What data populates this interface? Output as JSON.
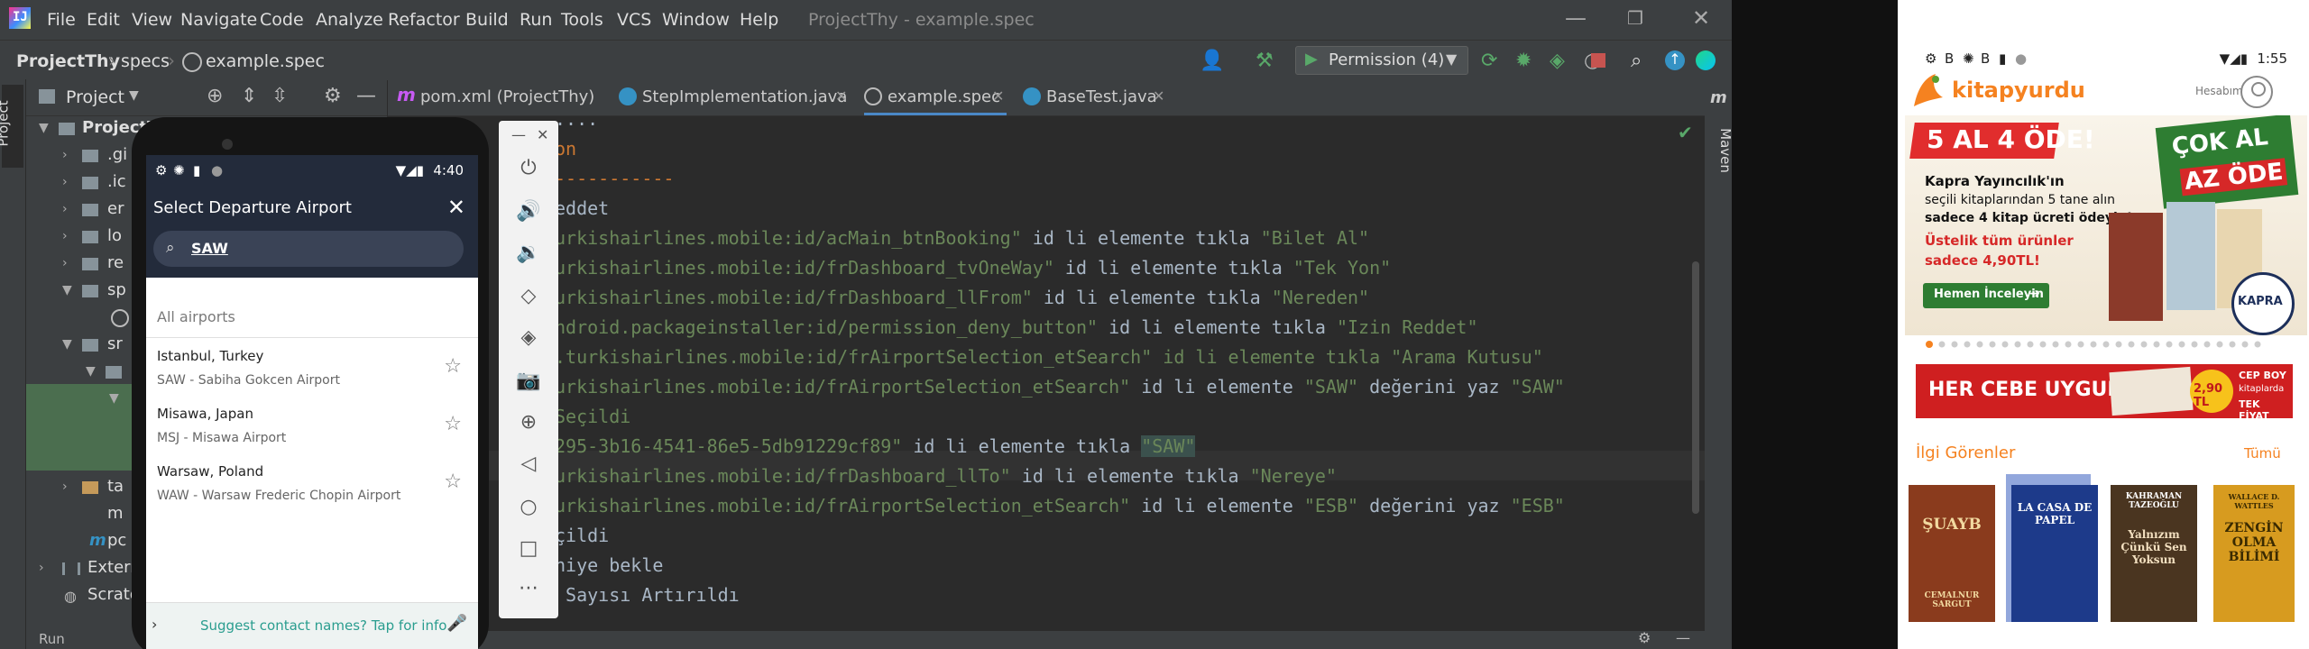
{
  "menubar": {
    "items": [
      "File",
      "Edit",
      "View",
      "Navigate",
      "Code",
      "Analyze",
      "Refactor",
      "Build",
      "Run",
      "Tools",
      "VCS",
      "Window",
      "Help"
    ],
    "window_title": "ProjectThy - example.spec",
    "controls": [
      "—",
      "❐",
      "✕"
    ]
  },
  "navbar": {
    "crumbs": [
      "ProjectThy",
      "specs",
      "example.spec"
    ],
    "run_config": "Permission (4)"
  },
  "project_panel": {
    "title": "Project",
    "tree": [
      {
        "label": "ProjectT"
      },
      {
        "label": ".gi"
      },
      {
        "label": ".ic"
      },
      {
        "label": "er"
      },
      {
        "label": "lo"
      },
      {
        "label": "re"
      },
      {
        "label": "sp"
      },
      {
        "label": ""
      },
      {
        "label": "sr"
      },
      {
        "label": ""
      },
      {
        "label": ""
      },
      {
        "label": ""
      },
      {
        "label": "ta"
      },
      {
        "label": "m"
      },
      {
        "label": "pc"
      },
      {
        "label": "Extern"
      },
      {
        "label": "Scrato"
      }
    ],
    "bottom_tab": "Run"
  },
  "left_stripe": {
    "project_tab": "Project"
  },
  "right_stripe": {
    "maven_tab": "Maven"
  },
  "editor_tabs": [
    {
      "label": "pom.xml (ProjectThy)",
      "color": "#c75af3"
    },
    {
      "label": "StepImplementation.java",
      "color": "#3592c4"
    },
    {
      "label": "example.spec",
      "color": "#9aa7b0",
      "active": true
    },
    {
      "label": "BaseTest.java",
      "color": "#3592c4"
    }
  ],
  "code": {
    "lines": [
      {
        "plain": "...."
      },
      {
        "kw": "on"
      },
      {
        "kw": "-----------"
      },
      {
        "plain": "eddet"
      },
      {
        "id": "urkishairlines.mobile:id/acMain_btnBooking\"",
        "mid": " id li elemente tıkla ",
        "val": "\"Bilet Al\""
      },
      {
        "id": "urkishairlines.mobile:id/frDashboard_tvOneWay\"",
        "mid": " id li elemente tıkla ",
        "val": "\"Tek Yon\""
      },
      {
        "id": "urkishairlines.mobile:id/frDashboard_llFrom\"",
        "mid": " id li elemente tıkla ",
        "val": "\"Nereden\""
      },
      {
        "id": "ndroid.packageinstaller:id/permission_deny_button\"",
        "mid": " id li elemente tıkla ",
        "val": "\"Izin Reddet\""
      },
      {
        "id": ".turkishairlines.mobile:id/frAirportSelection_etSearch\" id li elemente tıkla \"Arama Kutusu\"",
        "mid": "",
        "val": ""
      },
      {
        "id": "urkishairlines.mobile:id/frAirportSelection_etSearch\"",
        "mid": " id li elemente ",
        "val": "\"SAW\"",
        "tail": " değerini yaz ",
        "val2": "\"SAW\""
      },
      {
        "id": "Seçildi",
        "mid": "",
        "val": ""
      },
      {
        "id": "295-3b16-4541-86e5-5db91229cf89\"",
        "mid": " id li elemente tıkla ",
        "sel": "\"SAW\""
      },
      {
        "id": "urkishairlines.mobile:id/frDashboard_llTo\"",
        "mid": " id li elemente tıkla ",
        "val": "\"Nereye\""
      },
      {
        "id": "urkishairlines.mobile:id/frAirportSelection_etSearch\"",
        "mid": " id li elemente ",
        "val": "\"ESB\"",
        "tail": " değerini yaz ",
        "val2": "\"ESB\""
      },
      {
        "plain": "çildi"
      },
      {
        "plain": "niye bekle"
      },
      {
        "plain": " Sayısı Artırıldı"
      }
    ]
  },
  "emulator": {
    "status_time": "4:40",
    "screen_title": "Select Departure Airport",
    "search_value": "SAW",
    "section_label": "All airports",
    "airports": [
      {
        "city": "Istanbul, Turkey",
        "name": "SAW - Sabiha Gokcen Airport"
      },
      {
        "city": "Misawa, Japan",
        "name": "MSJ - Misawa Airport"
      },
      {
        "city": "Warsaw, Poland",
        "name": "WAW - Warsaw Frederic Chopin Airport"
      }
    ],
    "suggest_text": "Suggest contact names? Tap for info.",
    "toolbar_icons": [
      "power-icon",
      "volume-up-icon",
      "volume-down-icon",
      "rotate-left-icon",
      "rotate-right-icon",
      "camera-icon",
      "zoom-icon",
      "back-icon",
      "home-icon",
      "overview-icon",
      "more-icon"
    ]
  },
  "right_phone": {
    "status_time": "1:55",
    "brand": "kitapyurdu",
    "account_label": "Hesabım",
    "banner1": {
      "headline1": "5 AL 4 ÖDE!",
      "publisher_line": "Kapra Yayıncılık'ın",
      "offer_line1": "seçili kitaplarından 5 tane alın",
      "offer_line2": "sadece 4 kitap ücreti ödeyin!",
      "extra1": "Üstelik tüm ürünler",
      "extra2": "sadece 4,90TL!",
      "cta": "Hemen İnceleyin",
      "badge1": "ÇOK AL",
      "badge2": "AZ ÖDE",
      "logo_text": "KAPRA"
    },
    "banner2": {
      "headline": "HER CEBE UYGUN!",
      "price": "2,90 TL",
      "side1": "CEP BOY",
      "side2": "kitaplarda",
      "side3": "TEK FİYAT"
    },
    "section_title": "İlgi Görenler",
    "section_all": "Tümü",
    "books": [
      {
        "title": "ŞUAYB",
        "author": "CEMALNUR SARGUT",
        "color": "#8a3b1d"
      },
      {
        "title": "LA CASA DE PAPEL",
        "author": "",
        "color": "#1d3a8a"
      },
      {
        "title": "Yalnızım Çünkü Sen Yoksun",
        "author": "KAHRAMAN TAZEOĞLU",
        "color": "#4a3520"
      },
      {
        "title": "ZENGİN OLMA BİLİMİ",
        "author": "WALLACE D. WATTLES",
        "color": "#d79b1f"
      }
    ]
  }
}
